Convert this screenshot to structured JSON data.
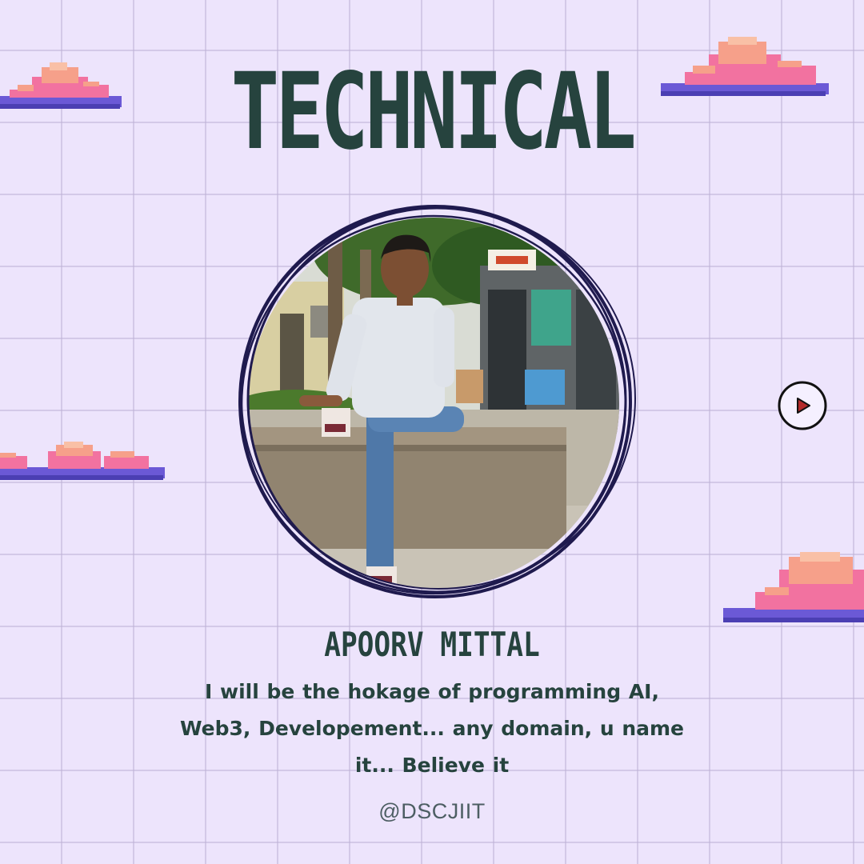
{
  "title": "TECHNICAL",
  "name": "APOORV MITTAL",
  "tagline_lines": [
    "I will be the hokage of programming  AI,",
    "Web3, Developement... any domain, u name",
    "it...  Believe it"
  ],
  "handle": "@DSCJIIT",
  "icons": {
    "play": "play-icon",
    "clouds": "pixel-cloud-icon"
  },
  "colors": {
    "background": "#ede4fc",
    "grid": "#beb2d6",
    "text_dark": "#26433e",
    "frame": "#1f1a4e",
    "cloud_top": "#f6a08a",
    "cloud_mid": "#f272a0",
    "cloud_base": "#6b59d6"
  }
}
